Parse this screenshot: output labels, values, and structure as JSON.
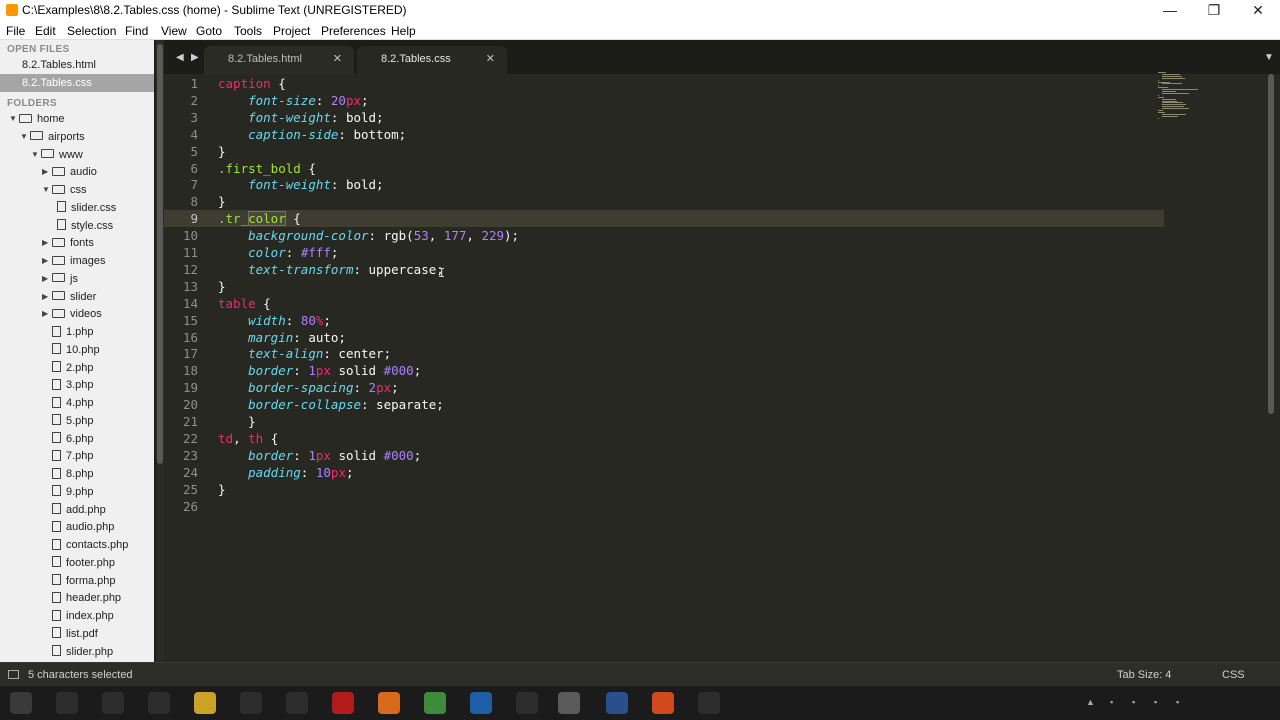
{
  "window": {
    "title": "C:\\Examples\\8\\8.2.Tables.css (home) - Sublime Text (UNREGISTERED)",
    "minimize_icon": "—",
    "maximize_icon": "❐",
    "close_icon": "✕"
  },
  "menu": [
    "File",
    "Edit",
    "Selection",
    "Find",
    "View",
    "Goto",
    "Tools",
    "Project",
    "Preferences",
    "Help"
  ],
  "sidebar": {
    "open_files_header": "OPEN FILES",
    "open_files": [
      {
        "label": "8.2.Tables.html",
        "active": false
      },
      {
        "label": "8.2.Tables.css",
        "active": true
      }
    ],
    "folders_header": "FOLDERS",
    "tree": [
      {
        "label": "home",
        "kind": "folder",
        "depth": 0,
        "expanded": true
      },
      {
        "label": "airports",
        "kind": "folder",
        "depth": 1,
        "expanded": true
      },
      {
        "label": "www",
        "kind": "folder",
        "depth": 2,
        "expanded": true
      },
      {
        "label": "audio",
        "kind": "folder",
        "depth": 3,
        "expanded": false
      },
      {
        "label": "css",
        "kind": "folder",
        "depth": 3,
        "expanded": true
      },
      {
        "label": "slider.css",
        "kind": "file",
        "depth": 4
      },
      {
        "label": "style.css",
        "kind": "file",
        "depth": 4
      },
      {
        "label": "fonts",
        "kind": "folder",
        "depth": 3,
        "expanded": false
      },
      {
        "label": "images",
        "kind": "folder",
        "depth": 3,
        "expanded": false
      },
      {
        "label": "js",
        "kind": "folder",
        "depth": 3,
        "expanded": false
      },
      {
        "label": "slider",
        "kind": "folder",
        "depth": 3,
        "expanded": false
      },
      {
        "label": "videos",
        "kind": "folder",
        "depth": 3,
        "expanded": false
      },
      {
        "label": "1.php",
        "kind": "file",
        "depth": 3
      },
      {
        "label": "10.php",
        "kind": "file",
        "depth": 3
      },
      {
        "label": "2.php",
        "kind": "file",
        "depth": 3
      },
      {
        "label": "3.php",
        "kind": "file",
        "depth": 3
      },
      {
        "label": "4.php",
        "kind": "file",
        "depth": 3
      },
      {
        "label": "5.php",
        "kind": "file",
        "depth": 3
      },
      {
        "label": "6.php",
        "kind": "file",
        "depth": 3
      },
      {
        "label": "7.php",
        "kind": "file",
        "depth": 3
      },
      {
        "label": "8.php",
        "kind": "file",
        "depth": 3
      },
      {
        "label": "9.php",
        "kind": "file",
        "depth": 3
      },
      {
        "label": "add.php",
        "kind": "file",
        "depth": 3
      },
      {
        "label": "audio.php",
        "kind": "file",
        "depth": 3
      },
      {
        "label": "contacts.php",
        "kind": "file",
        "depth": 3
      },
      {
        "label": "footer.php",
        "kind": "file",
        "depth": 3
      },
      {
        "label": "forma.php",
        "kind": "file",
        "depth": 3
      },
      {
        "label": "header.php",
        "kind": "file",
        "depth": 3
      },
      {
        "label": "index.php",
        "kind": "file",
        "depth": 3
      },
      {
        "label": "list.pdf",
        "kind": "file",
        "depth": 3
      },
      {
        "label": "slider.php",
        "kind": "file",
        "depth": 3
      }
    ]
  },
  "tabs": [
    {
      "label": "8.2.Tables.html",
      "active": false,
      "close": "✕"
    },
    {
      "label": "8.2.Tables.css",
      "active": true,
      "close": "✕"
    }
  ],
  "tab_nav": {
    "prev": "◀",
    "next": "▶",
    "dropdown": "▼"
  },
  "editor": {
    "current_line": 9,
    "lines": [
      [
        [
          "caption",
          "tag"
        ],
        [
          " {",
          "pun"
        ]
      ],
      [
        [
          "    ",
          ""
        ],
        [
          "font-size",
          "prop"
        ],
        [
          ": ",
          "pun"
        ],
        [
          "20",
          "num"
        ],
        [
          "px",
          "unit"
        ],
        [
          ";",
          "pun"
        ]
      ],
      [
        [
          "    ",
          ""
        ],
        [
          "font-weight",
          "prop"
        ],
        [
          ": bold;",
          "val"
        ]
      ],
      [
        [
          "    ",
          ""
        ],
        [
          "caption-side",
          "prop"
        ],
        [
          ": bottom;",
          "val"
        ]
      ],
      [
        [
          "}",
          "pun"
        ]
      ],
      [
        [
          ".first_bold",
          "cls"
        ],
        [
          " {",
          "pun"
        ]
      ],
      [
        [
          "    ",
          ""
        ],
        [
          "font-weight",
          "prop"
        ],
        [
          ": bold;",
          "val"
        ]
      ],
      [
        [
          "}",
          "pun"
        ]
      ],
      [
        [
          ".tr_",
          "cls"
        ],
        [
          "color",
          "cls hl"
        ],
        [
          " {",
          "pun"
        ]
      ],
      [
        [
          "    ",
          ""
        ],
        [
          "background-color",
          "prop"
        ],
        [
          ": rgb(",
          "val"
        ],
        [
          "53",
          "num"
        ],
        [
          ", ",
          "val"
        ],
        [
          "177",
          "num"
        ],
        [
          ", ",
          "val"
        ],
        [
          "229",
          "num"
        ],
        [
          ");",
          "val"
        ]
      ],
      [
        [
          "    ",
          ""
        ],
        [
          "color",
          "prop"
        ],
        [
          ": ",
          "pun"
        ],
        [
          "#fff",
          "num"
        ],
        [
          ";",
          "pun"
        ]
      ],
      [
        [
          "    ",
          ""
        ],
        [
          "text-transform",
          "prop"
        ],
        [
          ": uppercase;",
          "val"
        ]
      ],
      [
        [
          "}",
          "pun"
        ]
      ],
      [
        [
          "table",
          "tag"
        ],
        [
          " {",
          "pun"
        ]
      ],
      [
        [
          "    ",
          ""
        ],
        [
          "width",
          "prop"
        ],
        [
          ": ",
          "pun"
        ],
        [
          "80",
          "num"
        ],
        [
          "%",
          "unit"
        ],
        [
          ";",
          "pun"
        ]
      ],
      [
        [
          "    ",
          ""
        ],
        [
          "margin",
          "prop"
        ],
        [
          ": auto;",
          "val"
        ]
      ],
      [
        [
          "    ",
          ""
        ],
        [
          "text-align",
          "prop"
        ],
        [
          ": center;",
          "val"
        ]
      ],
      [
        [
          "    ",
          ""
        ],
        [
          "border",
          "prop"
        ],
        [
          ": ",
          "pun"
        ],
        [
          "1",
          "num"
        ],
        [
          "px",
          "unit"
        ],
        [
          " solid ",
          "val"
        ],
        [
          "#000",
          "num"
        ],
        [
          ";",
          "pun"
        ]
      ],
      [
        [
          "    ",
          ""
        ],
        [
          "border-spacing",
          "prop"
        ],
        [
          ": ",
          "pun"
        ],
        [
          "2",
          "num"
        ],
        [
          "px",
          "unit"
        ],
        [
          ";",
          "pun"
        ]
      ],
      [
        [
          "    ",
          ""
        ],
        [
          "border-collapse",
          "prop"
        ],
        [
          ": separate;",
          "val"
        ]
      ],
      [
        [
          "    }",
          "pun"
        ]
      ],
      [
        [
          "td",
          "tag"
        ],
        [
          ", ",
          "pun"
        ],
        [
          "th",
          "tag"
        ],
        [
          " {",
          "pun"
        ]
      ],
      [
        [
          "    ",
          ""
        ],
        [
          "border",
          "prop"
        ],
        [
          ": ",
          "pun"
        ],
        [
          "1",
          "num"
        ],
        [
          "px",
          "unit"
        ],
        [
          " solid ",
          "val"
        ],
        [
          "#000",
          "num"
        ],
        [
          ";",
          "pun"
        ]
      ],
      [
        [
          "    ",
          ""
        ],
        [
          "padding",
          "prop"
        ],
        [
          ": ",
          "pun"
        ],
        [
          "10",
          "num"
        ],
        [
          "px",
          "unit"
        ],
        [
          ";",
          "pun"
        ]
      ],
      [
        [
          "}",
          "pun"
        ]
      ],
      []
    ]
  },
  "statusbar": {
    "selection": "5 characters selected",
    "tab_size": "Tab Size: 4",
    "syntax": "CSS"
  },
  "colors": {
    "editor_bg": "#272822",
    "keyword": "#f92672",
    "class": "#a6e22e",
    "property": "#66d9ef",
    "number": "#ae81ff"
  }
}
